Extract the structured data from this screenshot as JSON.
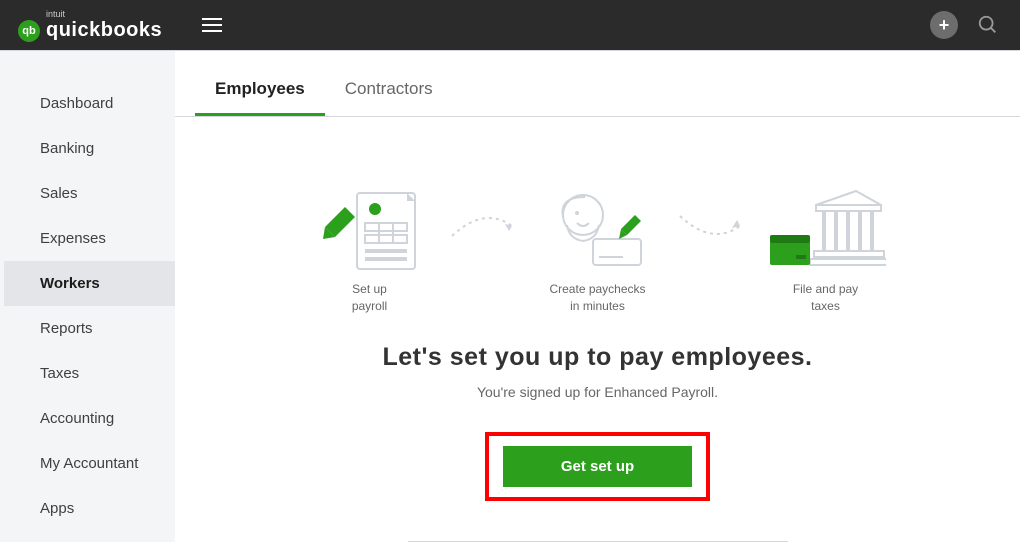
{
  "brand": {
    "name": "quickbooks",
    "parent": "intuit"
  },
  "sidebar": {
    "items": [
      {
        "label": "Dashboard"
      },
      {
        "label": "Banking"
      },
      {
        "label": "Sales"
      },
      {
        "label": "Expenses"
      },
      {
        "label": "Workers",
        "active": true
      },
      {
        "label": "Reports"
      },
      {
        "label": "Taxes"
      },
      {
        "label": "Accounting"
      },
      {
        "label": "My Accountant"
      },
      {
        "label": "Apps"
      }
    ]
  },
  "tabs": [
    {
      "label": "Employees",
      "active": true
    },
    {
      "label": "Contractors"
    }
  ],
  "steps": {
    "0": {
      "line1": "Set up",
      "line2": "payroll"
    },
    "1": {
      "line1": "Create paychecks",
      "line2": "in minutes"
    },
    "2": {
      "line1": "File and pay",
      "line2": "taxes"
    }
  },
  "hero": {
    "headline": "Let's set you up to pay employees.",
    "subline": "You're signed up for Enhanced Payroll.",
    "cta_label": "Get set up"
  }
}
